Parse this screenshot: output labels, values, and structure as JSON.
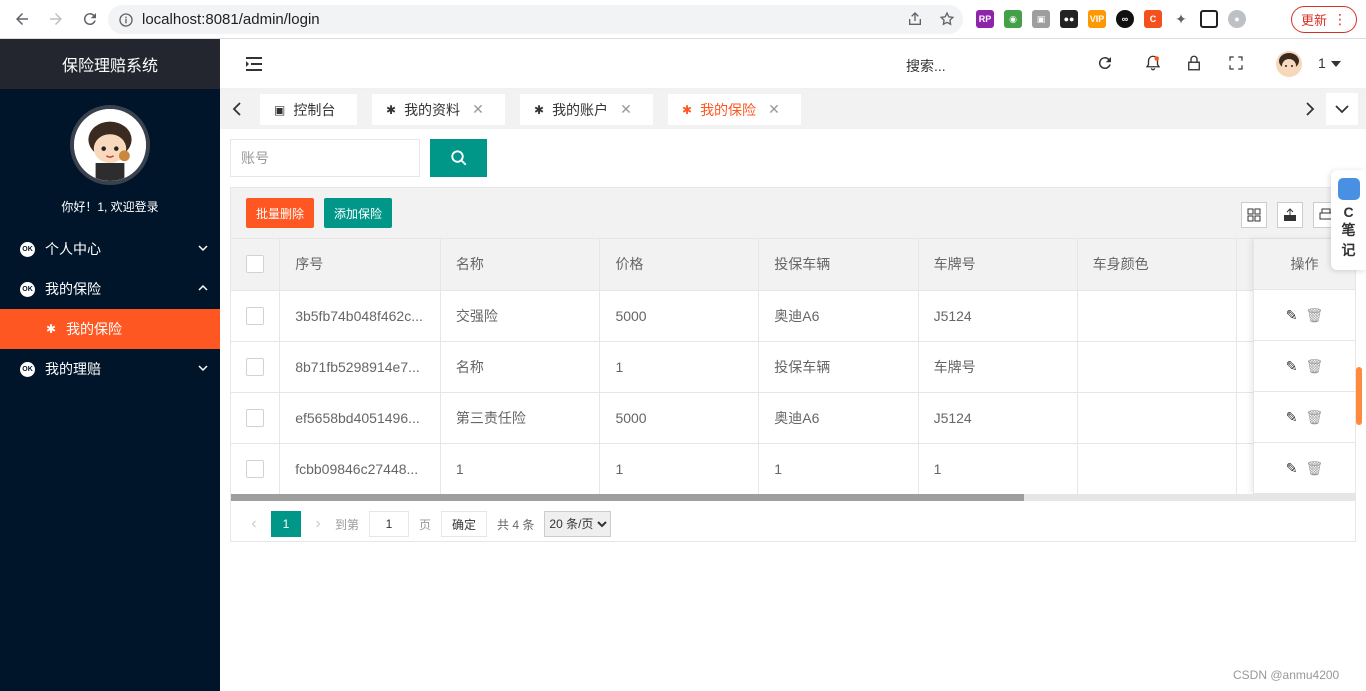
{
  "browser": {
    "url": "localhost:8081/admin/login",
    "update_label": "更新"
  },
  "sidebar": {
    "title": "保险理赔系统",
    "welcome": "你好！1, 欢迎登录",
    "menu": [
      {
        "icon": "ok",
        "label": "个人中心",
        "expanded": false
      },
      {
        "icon": "ok",
        "label": "我的保险",
        "expanded": true
      },
      {
        "icon": "palm",
        "label": "我的保险",
        "sub": true,
        "active": true
      },
      {
        "icon": "ok",
        "label": "我的理赔",
        "expanded": false
      }
    ]
  },
  "header": {
    "search_placeholder": "搜索...",
    "user": "1"
  },
  "tabs": [
    {
      "label": "控制台",
      "icon": "dashboard-icon",
      "closable": false
    },
    {
      "label": "我的资料",
      "icon": "palm-icon",
      "closable": true
    },
    {
      "label": "我的账户",
      "icon": "palm-icon",
      "closable": true
    },
    {
      "label": "我的保险",
      "icon": "palm-icon",
      "closable": true,
      "active": true
    }
  ],
  "search": {
    "placeholder": "账号"
  },
  "toolbar": {
    "batch_delete": "批量删除",
    "add": "添加保险"
  },
  "table": {
    "columns": [
      "序号",
      "名称",
      "价格",
      "投保车辆",
      "车牌号",
      "车身颜色"
    ],
    "action_column": "操作",
    "rows": [
      [
        "3b5fb74b048f462c...",
        "交强险",
        "5000",
        "奥迪A6",
        "J5124",
        ""
      ],
      [
        "8b71fb5298914e7...",
        "名称",
        "1",
        "投保车辆",
        "车牌号",
        ""
      ],
      [
        "ef5658bd4051496...",
        "第三责任险",
        "5000",
        "奥迪A6",
        "J5124",
        ""
      ],
      [
        "fcbb09846c27448...",
        "1",
        "1",
        "1",
        "1",
        ""
      ]
    ]
  },
  "pager": {
    "current": "1",
    "goto_label": "到第",
    "goto_value": "1",
    "page_unit": "页",
    "confirm": "确定",
    "total": "共 4 条",
    "page_size": "20 条/页"
  },
  "side_widget": {
    "line1": "C",
    "line2": "笔",
    "line3": "记"
  },
  "watermark": "CSDN @anmu4200",
  "colors": {
    "sidebar_bg": "#001529",
    "accent_orange": "#ff5722",
    "accent_teal": "#009688"
  }
}
